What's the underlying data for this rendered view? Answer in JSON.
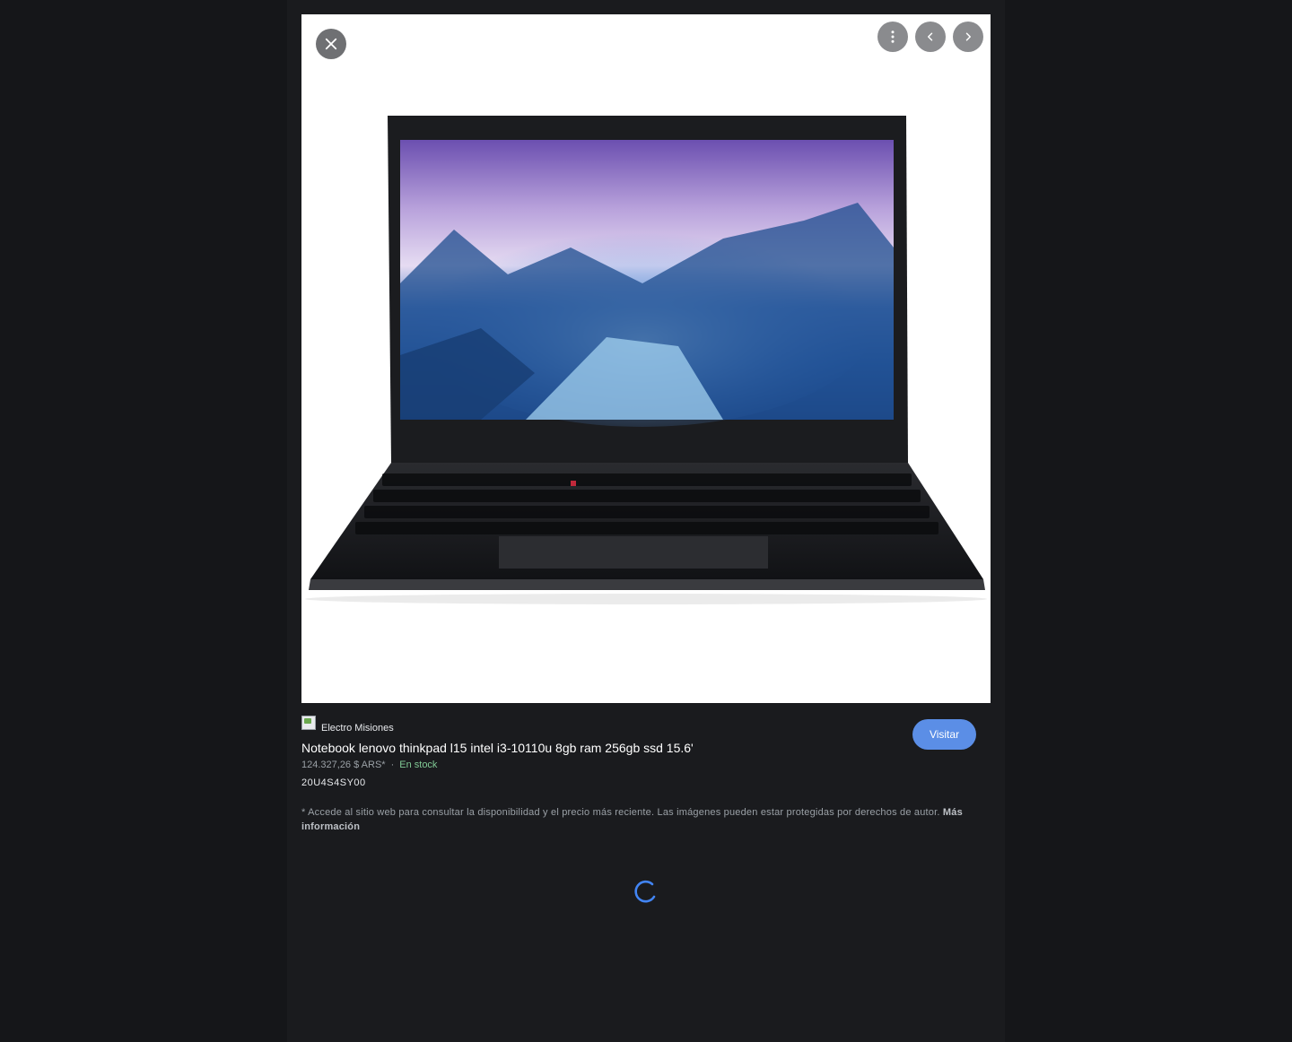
{
  "viewer": {
    "close_icon": "close-icon",
    "more_icon": "more-vert-icon",
    "prev_icon": "chevron-left-icon",
    "next_icon": "chevron-right-icon"
  },
  "image": {
    "subject": "laptop-product-photo"
  },
  "source": {
    "name": "Electro Misiones"
  },
  "product": {
    "title": "Notebook lenovo thinkpad l15 intel i3-10110u 8gb ram 256gb ssd 15.6'",
    "price": "124.327,26 $ ARS*",
    "separator": "·",
    "availability": "En stock",
    "sku": "20U4S4SY00"
  },
  "visit_button": {
    "label": "Visitar"
  },
  "disclaimer": {
    "text": "* Accede al sitio web para consultar la disponibilidad y el precio más reciente. Las imágenes pueden estar protegidas por derechos de autor.",
    "link": "Más información"
  },
  "colors": {
    "background": "#151619",
    "accent": "#5b8ee6",
    "in_stock": "#81c995",
    "spinner": "#4285f4"
  }
}
